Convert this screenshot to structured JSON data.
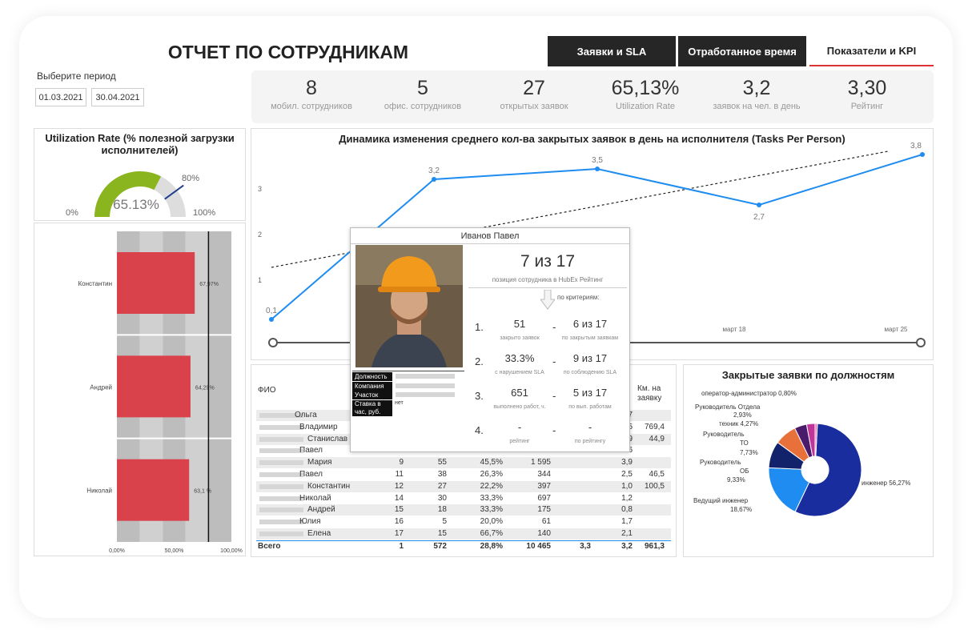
{
  "header": {
    "title": "ОТЧЕТ ПО СОТРУДНИКАМ",
    "tabs": [
      "Заявки и SLA",
      "Отработанное время",
      "Показатели и KPI"
    ]
  },
  "period": {
    "label": "Выберите период",
    "from": "01.03.2021",
    "to": "30.04.2021"
  },
  "kpis": [
    {
      "value": "8",
      "label": "мобил. сотрудников"
    },
    {
      "value": "5",
      "label": "офис. сотрудников"
    },
    {
      "value": "27",
      "label": "открытых заявок"
    },
    {
      "value": "65,13%",
      "label": "Utilization Rate"
    },
    {
      "value": "3,2",
      "label": "заявок на чел. в день"
    },
    {
      "value": "3,30",
      "label": "Рейтинг"
    }
  ],
  "gauge": {
    "title": "Utilization Rate (% полезной загрузки исполнителей)",
    "value": "65.13%",
    "fraction": 0.6513,
    "target": "80%",
    "min": "0%",
    "max": "100%",
    "fill_color": "#8ab51e"
  },
  "util_bars": {
    "names": [
      "Константин",
      "Андрей",
      "Николай"
    ],
    "values": [
      67.97,
      64.29,
      63.1
    ],
    "labels": [
      "67,97%",
      "64,29%",
      "63,1 %"
    ],
    "ticks": [
      "0,00%",
      "50,00%",
      "100,00%"
    ],
    "color": "#d9414b"
  },
  "line_chart": {
    "title": "Динамика изменения среднего кол-ва закрытых заявок в день на исполнителя (Tasks Per Person)",
    "y_ticks": [
      "3",
      "2",
      "1"
    ],
    "point_labels": [
      "0,1",
      "3,2",
      "3,5",
      "2,7",
      "3,8"
    ],
    "x_labels": [
      "март  18",
      "март  25"
    ]
  },
  "popup": {
    "name": "Иванов Павел",
    "rank": "7  из 17",
    "rank_caption": "позиция сотрудника в HubEx Рейтинг",
    "criteria_label": "по критериям:",
    "criteria": [
      {
        "n": "1.",
        "val": "51",
        "val_cap": "закрыто заявок",
        "pos": "6 из 17",
        "pos_cap": "по закрытым заявкам"
      },
      {
        "n": "2.",
        "val": "33.3%",
        "val_cap": "с нарушением SLA",
        "pos": "9 из 17",
        "pos_cap": "по соблюдению SLA"
      },
      {
        "n": "3.",
        "val": "651",
        "val_cap": "выполнено работ, ч.",
        "pos": "5 из 17",
        "pos_cap": "по вып. работам"
      },
      {
        "n": "4.",
        "val": "-",
        "val_cap": "рейтинг",
        "pos": "-",
        "pos_cap": "по рейтингу"
      }
    ],
    "fields": [
      "Должность",
      "Компания",
      "Участок",
      "Ставка в час, руб."
    ],
    "rate_value": "нет"
  },
  "table": {
    "col_fio": "ФИО",
    "col_km": "Км. на заявку",
    "rows": [
      [
        "Ольга",
        "",
        "",
        "",
        "",
        "7",
        ""
      ],
      [
        "Владимир",
        "",
        "",
        "",
        "",
        "5",
        "769,4"
      ],
      [
        "Станислав",
        "",
        "",
        "",
        "",
        "9",
        "44,9"
      ],
      [
        "Павел",
        "",
        "",
        "",
        "",
        "6",
        ""
      ],
      [
        "Мария",
        "9",
        "55",
        "45,5%",
        "1 595",
        "3,9",
        ""
      ],
      [
        "Павел",
        "11",
        "38",
        "26,3%",
        "344",
        "2,5",
        "46,5"
      ],
      [
        "Константин",
        "12",
        "27",
        "22,2%",
        "397",
        "1,0",
        "100,5"
      ],
      [
        "Николай",
        "14",
        "30",
        "33,3%",
        "697",
        "1,2",
        ""
      ],
      [
        "Андрей",
        "15",
        "18",
        "33,3%",
        "175",
        "0,8",
        ""
      ],
      [
        "Юлия",
        "16",
        "5",
        "20,0%",
        "61",
        "1,7",
        ""
      ],
      [
        "Елена",
        "17",
        "15",
        "66,7%",
        "140",
        "2,1",
        ""
      ]
    ],
    "total": [
      "Всего",
      "1",
      "572",
      "28,8%",
      "10 465",
      "3,3",
      "3,2",
      "961,3"
    ]
  },
  "pie": {
    "title": "Закрытые заявки по должностям",
    "labels": [
      "оператор-администратор 0,80%",
      "Руководитель Отдела",
      "2,93%",
      "техник 4,27%",
      "Руководитель",
      "ТО",
      "7,73%",
      "Руководитель",
      "ОБ",
      "9,33%",
      "Ведущий инженер",
      "18,67%",
      "инженер 56,27%"
    ],
    "chart_data": {
      "type": "pie",
      "categories": [
        "инженер",
        "Ведущий инженер",
        "Руководитель ОБ",
        "Руководитель ТО",
        "техник",
        "Руководитель Отдела",
        "оператор-администратор"
      ],
      "values": [
        56.27,
        18.67,
        9.33,
        7.73,
        4.27,
        2.93,
        0.8
      ],
      "colors": [
        "#1a2d9e",
        "#1e8cf0",
        "#12236b",
        "#e8703a",
        "#4a1a6b",
        "#c0359a",
        "#e86cb0"
      ]
    }
  }
}
